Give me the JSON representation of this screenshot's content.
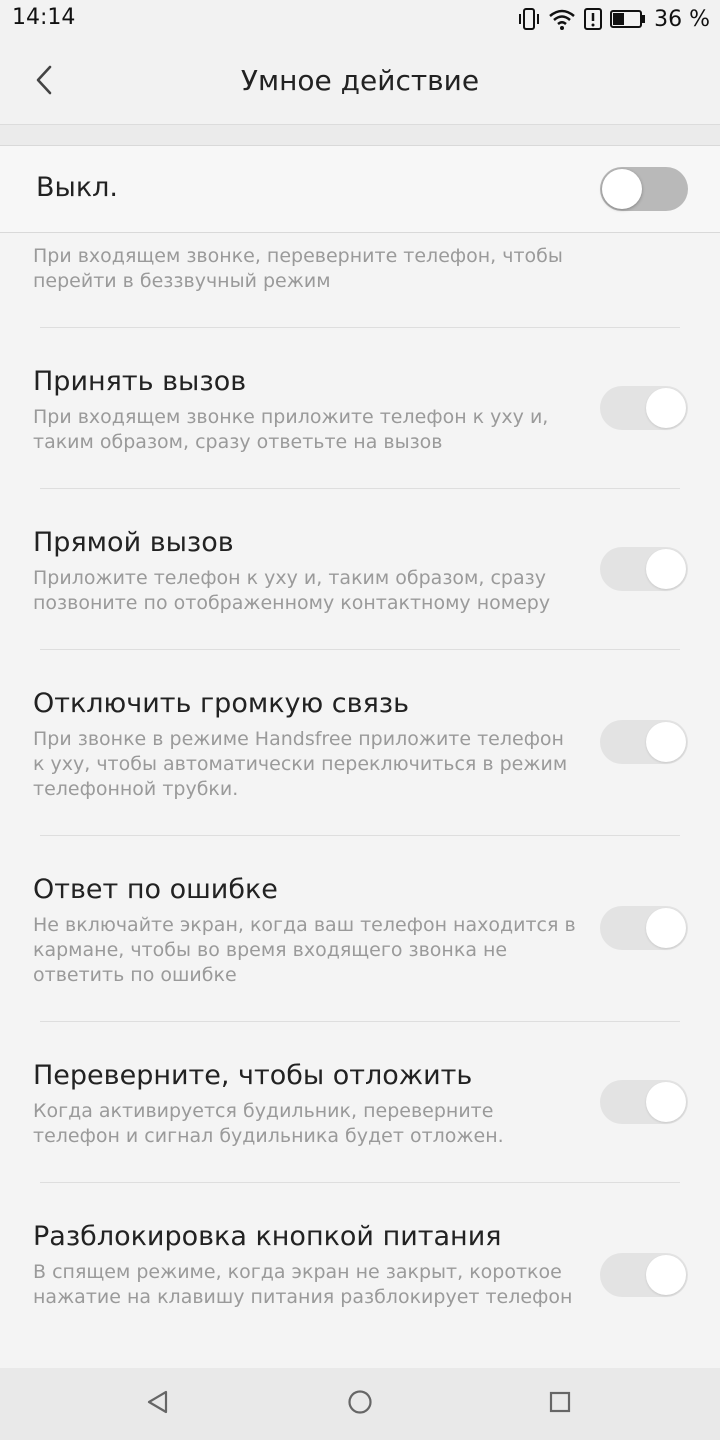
{
  "status_bar": {
    "time": "14:14",
    "battery_text": "36 %",
    "icons": [
      "vibrate-icon",
      "wifi-icon",
      "alert-icon",
      "battery-icon"
    ]
  },
  "app_bar": {
    "title": "Умное действие",
    "back_icon": "chevron-left-icon"
  },
  "master": {
    "label": "Выкл.",
    "enabled": false
  },
  "items": [
    {
      "title": "",
      "desc": "При входящем звонке, переверните телефон, чтобы перейти в беззвучный режим",
      "enabled": false
    },
    {
      "title": "Принять вызов",
      "desc": "При входящем звонке приложите телефон к уху и, таким образом, сразу ответьте на вызов",
      "enabled": false
    },
    {
      "title": "Прямой вызов",
      "desc": "Приложите телефон к уху и, таким образом, сразу позвоните по отображенному контактному номеру",
      "enabled": false
    },
    {
      "title": "Отключить громкую связь",
      "desc": "При звонке в режиме Handsfree приложите телефон к уху, чтобы автоматически переключиться в режим телефонной трубки.",
      "enabled": false
    },
    {
      "title": "Ответ по ошибке",
      "desc": "Не включайте экран, когда ваш телефон находится в кармане, чтобы во время входящего звонка не ответить по ошибке",
      "enabled": false
    },
    {
      "title": "Переверните, чтобы отложить",
      "desc": "Когда активируется будильник, переверните телефон и сигнал будильника будет отложен.",
      "enabled": false
    },
    {
      "title": "Разблокировка кнопкой питания",
      "desc": "В спящем режиме, когда экран не закрыт, короткое нажатие на клавишу питания разблокирует телефон",
      "enabled": false
    }
  ],
  "nav_bar": {
    "icons": [
      "back-triangle-icon",
      "home-circle-icon",
      "recents-square-icon"
    ]
  },
  "colors": {
    "background": "#f4f4f4",
    "toggle_track_disabled": "#e3e3e3",
    "toggle_track_master_off": "#b9b9b9",
    "description_text": "#9a9a9a"
  }
}
